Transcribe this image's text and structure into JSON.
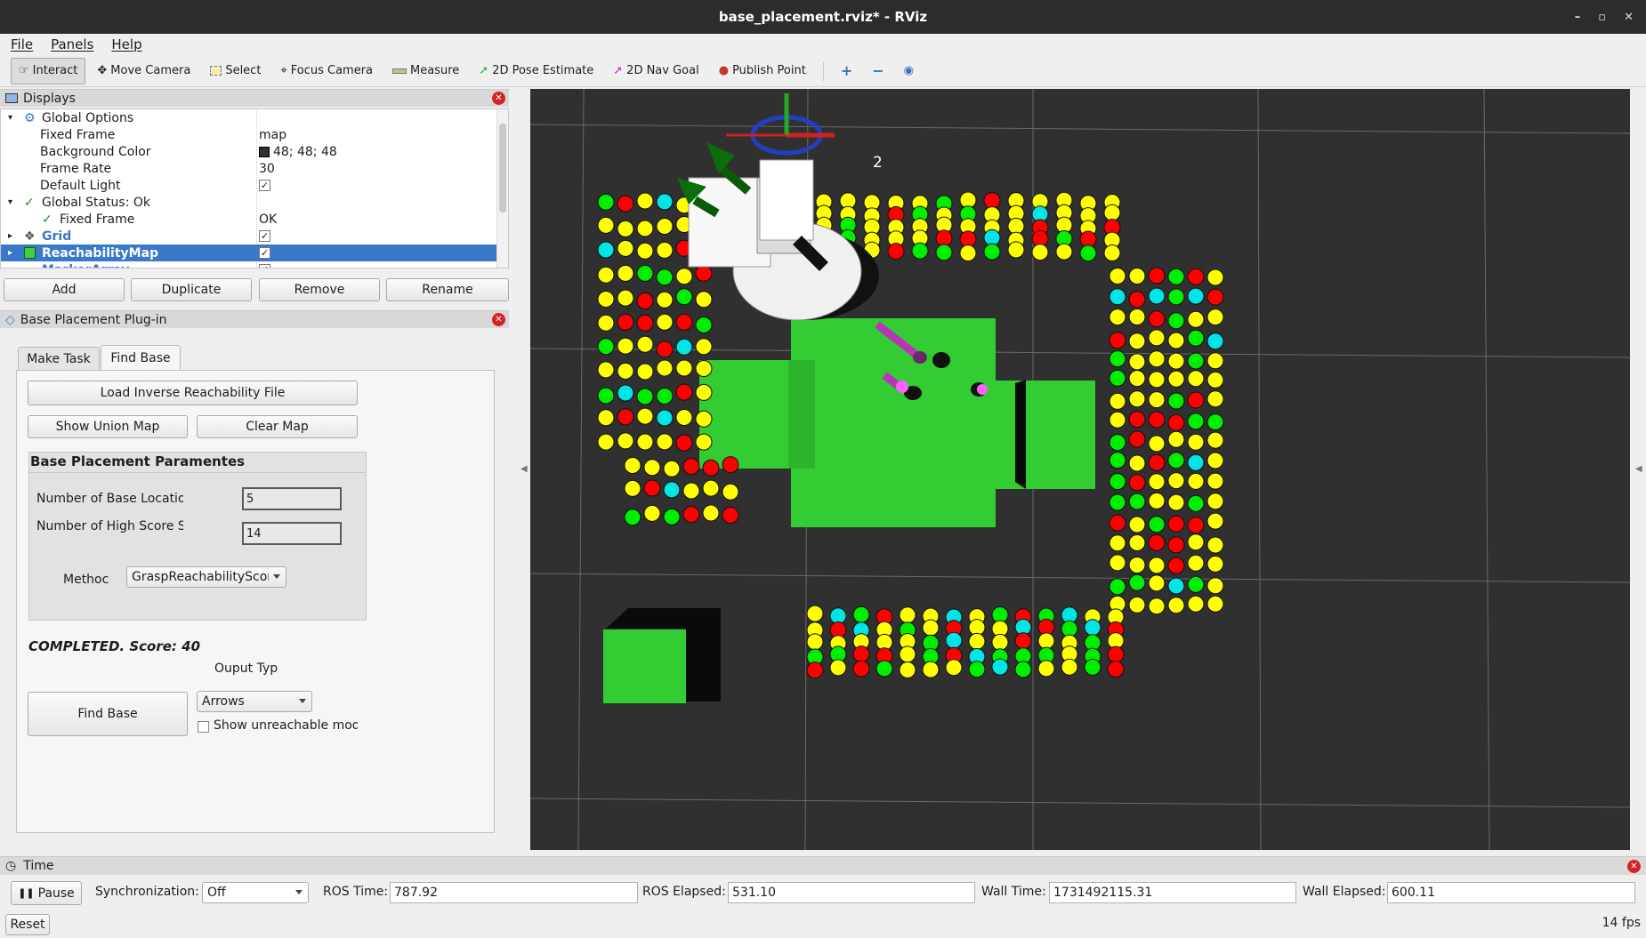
{
  "window": {
    "title": "base_placement.rviz* - RViz",
    "controls": [
      "–",
      "▫",
      "✕"
    ]
  },
  "menu": {
    "items": [
      "File",
      "Panels",
      "Help"
    ]
  },
  "toolbar": {
    "tools": [
      {
        "label": "Interact",
        "icon": "pointer-icon"
      },
      {
        "label": "Move Camera",
        "icon": "move-camera-icon"
      },
      {
        "label": "Select",
        "icon": "select-icon"
      },
      {
        "label": "Focus Camera",
        "icon": "focus-camera-icon"
      },
      {
        "label": "Measure",
        "icon": "measure-icon"
      },
      {
        "label": "2D Pose Estimate",
        "icon": "pose-estimate-icon"
      },
      {
        "label": "2D Nav Goal",
        "icon": "nav-goal-icon"
      },
      {
        "label": "Publish Point",
        "icon": "publish-point-icon"
      }
    ],
    "extra_icons": [
      "plus-icon",
      "minus-icon",
      "eye-icon"
    ]
  },
  "displays": {
    "title": "Displays",
    "rows": [
      {
        "key": "Global Options",
        "value": ""
      },
      {
        "key": "Fixed Frame",
        "value": "map"
      },
      {
        "key": "Background Color",
        "value": "48; 48; 48"
      },
      {
        "key": "Frame Rate",
        "value": "30"
      },
      {
        "key": "Default Light",
        "value": "✓"
      },
      {
        "key": "Global Status: Ok",
        "value": ""
      },
      {
        "key": "Fixed Frame",
        "value": "OK"
      },
      {
        "key": "Grid",
        "value": "✓"
      },
      {
        "key": "ReachabilityMap",
        "value": "✓"
      },
      {
        "key": "MarkerArray",
        "value": "✓"
      }
    ],
    "buttons": {
      "add": "Add",
      "duplicate": "Duplicate",
      "remove": "Remove",
      "rename": "Rename"
    },
    "bg_color": "#303030"
  },
  "plugin": {
    "title": "Base Placement Plug-in",
    "tabs": [
      "Make Task",
      "Find Base"
    ],
    "load_button": "Load Inverse Reachability File",
    "show_union_button": "Show Union Map",
    "clear_map_button": "Clear Map",
    "group_title": "Base Placement Paramentes",
    "num_base_label": "Number of Base Locatio",
    "num_base_value": "5",
    "num_high_label": "Number of High Score Spher",
    "num_high_value": "14",
    "method_label": "Methoc",
    "method_value": "GraspReachabilityScore",
    "status": "COMPLETED. Score: 40",
    "output_type_label": "Ouput Typ",
    "find_base_button": "Find Base",
    "output_type_value": "Arrows",
    "show_unreachable_label": "Show unreachable mode"
  },
  "viewport": {
    "label": "2",
    "bg": "#303030"
  },
  "time": {
    "title": "Time",
    "pause": "Pause",
    "sync_label": "Synchronization:",
    "sync_value": "Off",
    "ros_time_label": "ROS Time:",
    "ros_time": "787.92",
    "ros_elapsed_label": "ROS Elapsed:",
    "ros_elapsed": "531.10",
    "wall_time_label": "Wall Time:",
    "wall_time": "1731492115.31",
    "wall_elapsed_label": "Wall Elapsed:",
    "wall_elapsed": "600.11"
  },
  "status": {
    "reset": "Reset",
    "fps": "14 fps"
  }
}
